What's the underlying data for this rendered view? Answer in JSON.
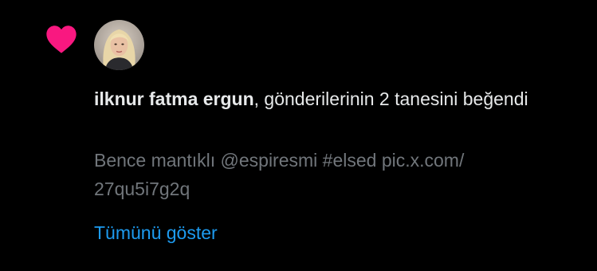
{
  "colors": {
    "background": "#000000",
    "heart": "#f91880",
    "primary_text": "#e7e9ea",
    "secondary_text": "#71767b",
    "link": "#1d9bf0"
  },
  "notification": {
    "icon": "heart-icon",
    "avatar_icon": "user-avatar",
    "user_name": "ilknur fatma ergun",
    "action_text": ", gönderilerinin 2 tanesini beğendi",
    "tweet_preview_line1": "Bence mantıklı @espiresmi #elsed pic.x.com/",
    "tweet_preview_line2": "27qu5i7g2q",
    "show_all_label": "Tümünü göster"
  }
}
